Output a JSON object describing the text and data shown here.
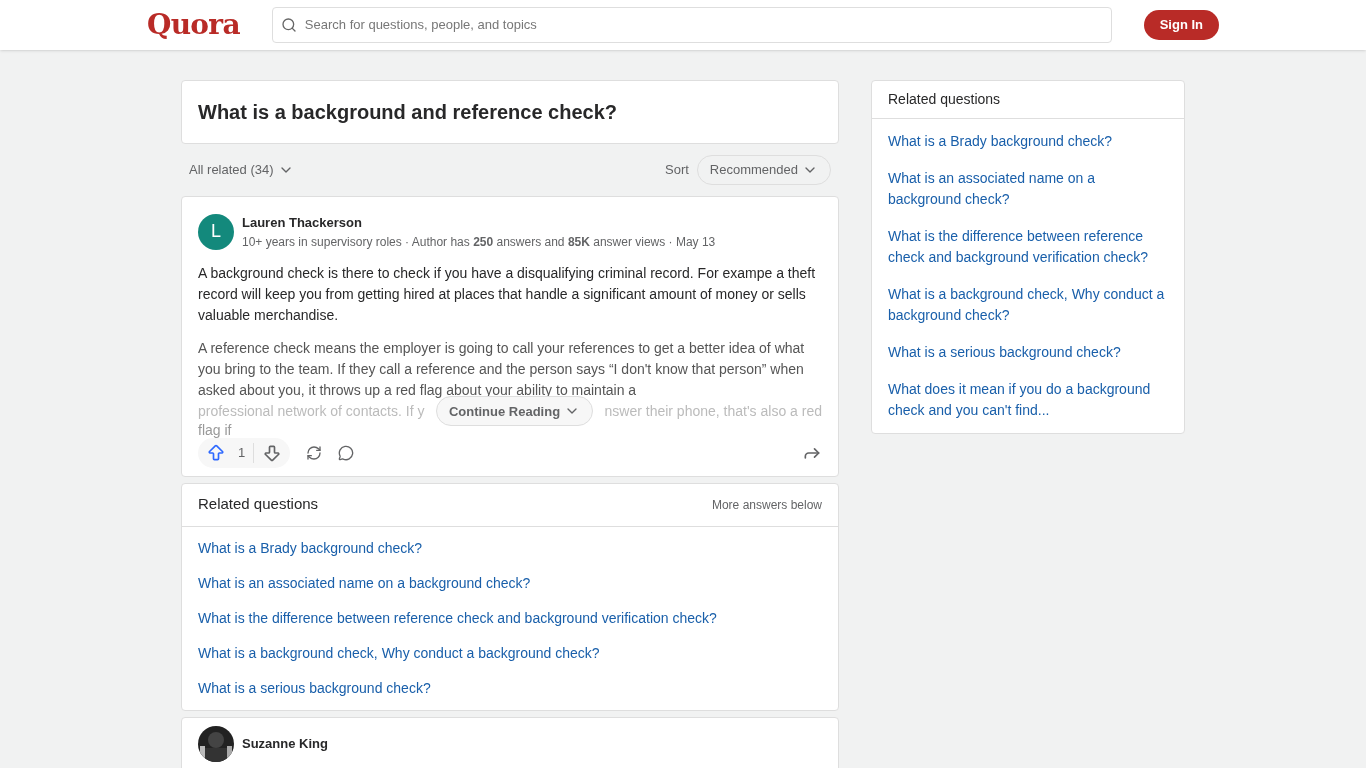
{
  "header": {
    "logo": "Quora",
    "search": {
      "placeholder": "Search for questions, people, and topics"
    },
    "sign_in": "Sign In"
  },
  "question": {
    "title": "What is a background and reference check?"
  },
  "filter": {
    "label": "All related (34)",
    "sort_label": "Sort",
    "sort_value": "Recommended"
  },
  "answer": {
    "avatar_letter": "L",
    "author": "Lauren Thackerson",
    "credentials": "10+ years in supervisory roles · Author has **250** answers and **85K** answer views · May 13",
    "paragraph_1": "A background check is there to check if you have a disqualifying criminal record. For exampe a theft record will keep you from getting hired at places that handle a significant amount of money or sells valuable merchandise.",
    "paragraph_2": "A reference check means the employer is going to call your references to get a better idea of what you bring to the team. If they call a reference and the person says “I don't know that person” when asked about you, it throws up a red flag about your ability to maintain a",
    "faded_left": "professional network of contacts. If y",
    "faded_right": "nswer their phone, that's also a red",
    "faded_last": "flag if",
    "continue": "Continue Reading",
    "upvotes": "1"
  },
  "inline_related": {
    "title": "Related questions",
    "note": "More answers below",
    "items": [
      "What is a Brady background check?",
      "What is an associated name on a background check?",
      "What is the difference between reference check and background verification check?",
      "What is a background check, Why conduct a background check?",
      "What is a serious background check?"
    ]
  },
  "next_answer": {
    "author": "Suzanne King"
  },
  "sidebar_related": {
    "title": "Related questions",
    "items": [
      "What is a Brady background check?",
      "What is an associated name on a background check?",
      "What is the difference between reference check and background verification check?",
      "What is a background check, Why conduct a background check?",
      "What is a serious background check?",
      "What does it mean if you do a background check and you can't find..."
    ]
  }
}
